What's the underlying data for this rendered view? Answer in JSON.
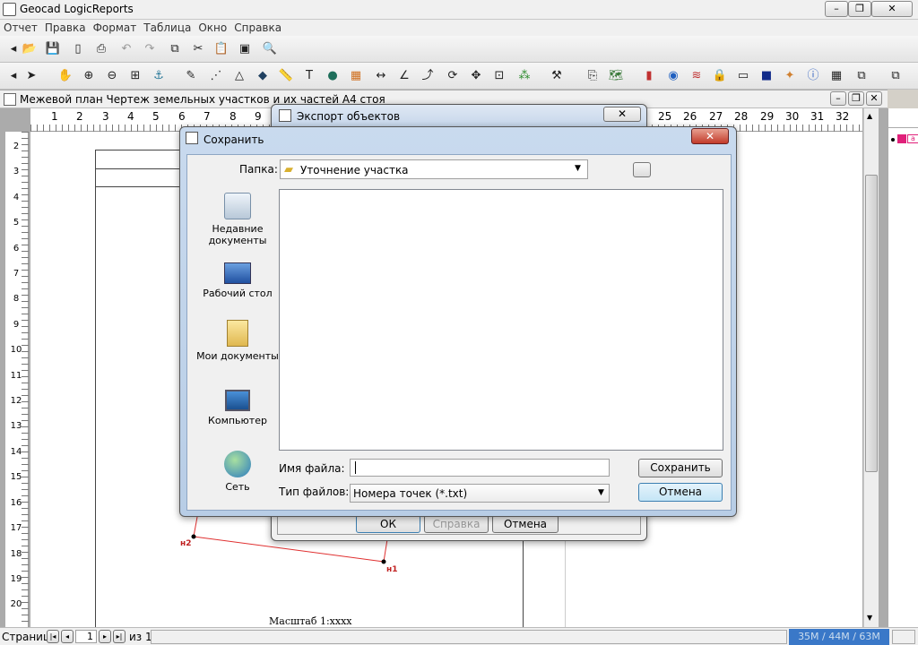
{
  "app": {
    "title": "Geocad LogicReports"
  },
  "menu": [
    "Отчет",
    "Правка",
    "Формат",
    "Таблица",
    "Окно",
    "Справка"
  ],
  "document": {
    "title": "Межевой план Чертеж земельных участков и их частей А4 стоя"
  },
  "ruler": {
    "h_ticks": [
      "1",
      "2",
      "3",
      "4",
      "5",
      "6",
      "7",
      "8",
      "9",
      "25",
      "26",
      "27",
      "28",
      "29",
      "30",
      "31",
      "32"
    ],
    "v_ticks": [
      "2",
      "3",
      "4",
      "5",
      "6",
      "7",
      "8",
      "9",
      "10",
      "11",
      "12",
      "13",
      "14",
      "15",
      "16",
      "17",
      "18",
      "19",
      "20"
    ]
  },
  "drawing": {
    "point1": "н1",
    "point2": "н2",
    "scale_text": "Масштаб 1:xxxx"
  },
  "export_dialog": {
    "title": "Экспорт объектов",
    "ok": "ОК",
    "help": "Справка",
    "cancel": "Отмена"
  },
  "save_dialog": {
    "title": "Сохранить",
    "folder_label": "Папка:",
    "folder_value": "Уточнение участка",
    "places": [
      "Недавние документы",
      "Рабочий стол",
      "Мои документы",
      "Компьютер",
      "Сеть"
    ],
    "filename_label": "Имя файла:",
    "filename_value": "",
    "filetype_label": "Тип файлов:",
    "filetype_value": "Номера точек (*.txt)",
    "save_button": "Сохранить",
    "cancel_button": "Отмена"
  },
  "status": {
    "page_label": "Страница",
    "page_current": "1",
    "page_of": "из 1",
    "memory": "35M / 44M / 63M"
  },
  "colors": {
    "accent": "#316ac5",
    "memory_bg": "#3a78c8",
    "red_line": "#e03030"
  }
}
